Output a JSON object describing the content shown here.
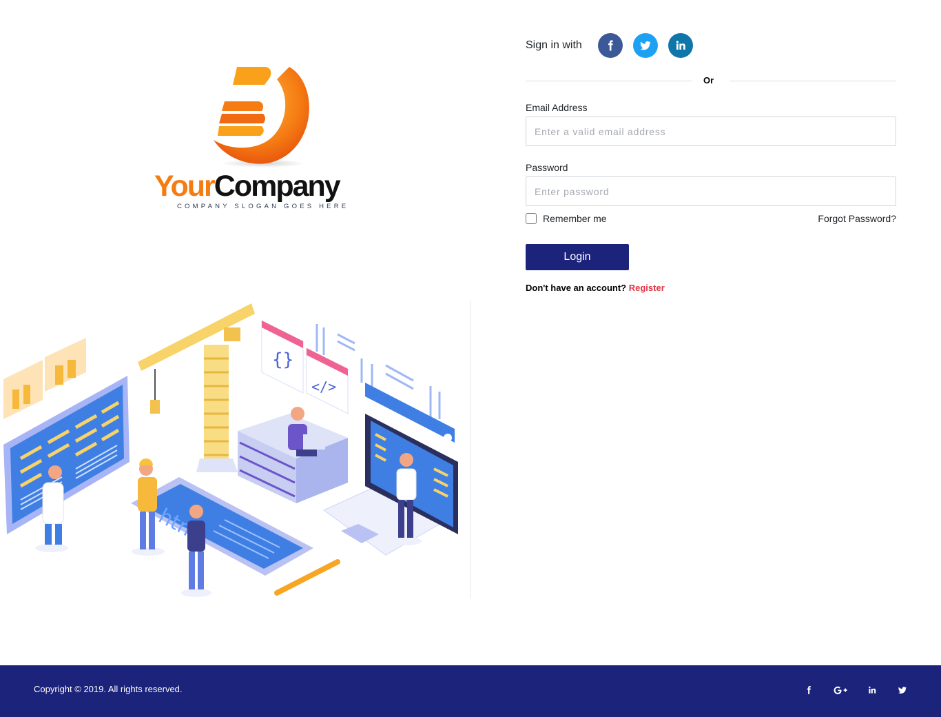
{
  "brand": {
    "name_part1": "Your",
    "name_part2": "Company",
    "slogan": "COMPANY SLOGAN GOES HERE",
    "colors": {
      "orange": "#f57c13",
      "dark": "#111111"
    }
  },
  "illustration": {
    "label": "html"
  },
  "social_login": {
    "label": "Sign in with",
    "providers": [
      {
        "name": "facebook",
        "icon": "facebook-icon",
        "color": "#3b5998"
      },
      {
        "name": "twitter",
        "icon": "twitter-icon",
        "color": "#1da1f2"
      },
      {
        "name": "linkedin",
        "icon": "linkedin-icon",
        "color": "#0e76a8"
      }
    ]
  },
  "divider": {
    "text": "Or"
  },
  "form": {
    "email": {
      "label": "Email Address",
      "placeholder": "Enter a valid email address",
      "value": ""
    },
    "password": {
      "label": "Password",
      "placeholder": "Enter password",
      "value": ""
    },
    "remember": {
      "label": "Remember me",
      "checked": false
    },
    "forgot_label": "Forgot Password?",
    "login_label": "Login",
    "no_account_text": "Don't have an account?",
    "register_label": "Register"
  },
  "footer": {
    "copyright": "Copyright © 2019. All rights reserved.",
    "icons": [
      "facebook-icon",
      "google-plus-icon",
      "linkedin-icon",
      "twitter-icon"
    ]
  },
  "colors": {
    "primary": "#1b237a",
    "register_link": "#dc3545"
  }
}
